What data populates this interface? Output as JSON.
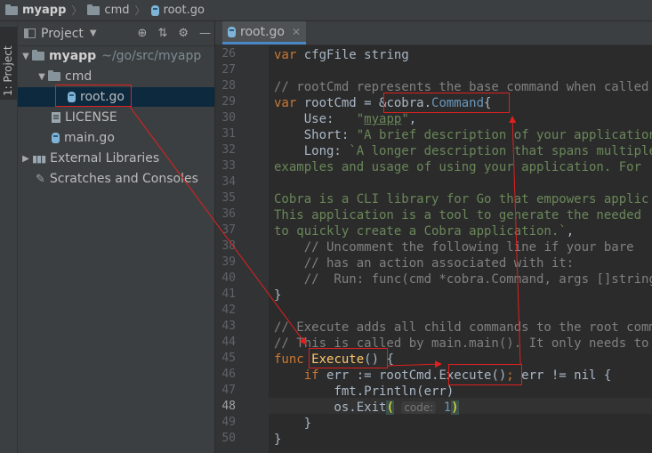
{
  "breadcrumb": {
    "project": "myapp",
    "folder": "cmd",
    "file": "root.go"
  },
  "sidestrip": {
    "label": "1: Project"
  },
  "project_panel": {
    "title": "Project",
    "tree": [
      {
        "label": "myapp",
        "path": "~/go/src/myapp",
        "type": "folder",
        "expanded": true
      },
      {
        "label": "cmd",
        "type": "folder",
        "expanded": true
      },
      {
        "label": "root.go",
        "type": "go-file",
        "selected": true
      },
      {
        "label": "LICENSE",
        "type": "text-file"
      },
      {
        "label": "main.go",
        "type": "go-file"
      },
      {
        "label": "External Libraries",
        "type": "libraries"
      },
      {
        "label": "Scratches and Consoles",
        "type": "scratches"
      }
    ]
  },
  "editor": {
    "tab": "root.go",
    "current_line": 48,
    "lines": [
      {
        "n": "26",
        "html": "<span class='kw'>var</span> cfgFile string"
      },
      {
        "n": "27",
        "html": ""
      },
      {
        "n": "28",
        "html": "<span class='cm'>// rootCmd represents the base command when called</span>"
      },
      {
        "n": "29",
        "html": "<span class='kw'>var</span> rootCmd = &amp;cobra.<span class='ty'>Command</span>{"
      },
      {
        "n": "30",
        "html": "    Use:   <span class='st'>\"</span><span class='ul'>myapp</span><span class='st'>\"</span>,"
      },
      {
        "n": "31",
        "html": "    Short: <span class='st'>\"A brief description of your application\"</span>,"
      },
      {
        "n": "32",
        "html": "    Long: <span class='st'>`A longer description that spans multiple</span>"
      },
      {
        "n": "33",
        "html": "<span class='st'>examples and usage of using your application. For</span>"
      },
      {
        "n": "34",
        "html": ""
      },
      {
        "n": "35",
        "html": "<span class='st'>Cobra is a CLI library for Go that empowers applic</span>"
      },
      {
        "n": "36",
        "html": "<span class='st'>This application is a tool to generate the needed</span>"
      },
      {
        "n": "37",
        "html": "<span class='st'>to quickly create a Cobra application.`</span>,"
      },
      {
        "n": "38",
        "html": "    <span class='cm'>// Uncomment the following line if your bare</span>"
      },
      {
        "n": "39",
        "html": "    <span class='cm'>// has an action associated with it:</span>"
      },
      {
        "n": "40",
        "html": "    <span class='cm'>//  Run: func(cmd *cobra.Command, args []string</span>"
      },
      {
        "n": "41",
        "html": "}"
      },
      {
        "n": "42",
        "html": ""
      },
      {
        "n": "43",
        "html": "<span class='cm'>// Execute adds all child commands to the root comm</span>"
      },
      {
        "n": "44",
        "html": "<span class='cm'>// This is called by main.main(). It only needs to</span>"
      },
      {
        "n": "45",
        "html": "<span class='kw'>func</span> <span class='fn'>Execute</span>() {"
      },
      {
        "n": "46",
        "html": "    <span class='kw'>if</span> err := rootCmd.Execute()<span class='kw'>;</span> err != nil {"
      },
      {
        "n": "47",
        "html": "        fmt.Println(err)"
      },
      {
        "n": "48",
        "html": "        os.Exit<span class='brmatch'>(</span> <span class='hint'>code:</span> <span class='ty'>1</span><span class='brmatch'>)</span>"
      },
      {
        "n": "49",
        "html": "    }"
      },
      {
        "n": "50",
        "html": "}"
      }
    ]
  },
  "colors": {
    "annotation": "#e02020",
    "selection": "#0d293e",
    "background": "#2b2b2b"
  }
}
